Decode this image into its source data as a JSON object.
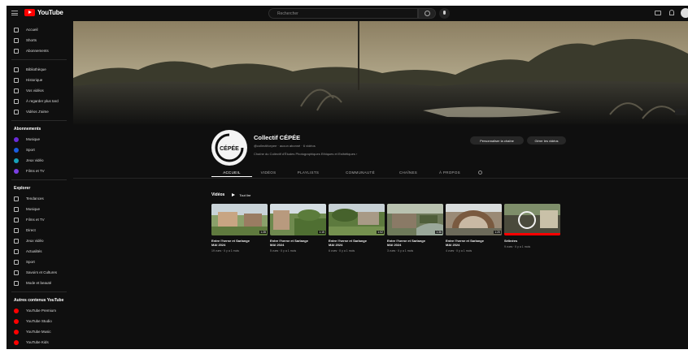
{
  "topbar": {
    "logo_text": "YouTube",
    "search_placeholder": "Rechercher"
  },
  "sidebar": {
    "main": [
      "Accueil",
      "Shorts",
      "Abonnements"
    ],
    "library": [
      "Bibliothèque",
      "Historique",
      "Vos vidéos",
      "À regarder plus tard",
      "Vidéos J'aime"
    ],
    "subs_title": "Abonnements",
    "subs": [
      {
        "label": "Musique",
        "color": "#6b2bd9"
      },
      {
        "label": "Sport",
        "color": "#1a5ce0"
      },
      {
        "label": "Jeux vidéo",
        "color": "#17a2b8"
      },
      {
        "label": "Films et TV",
        "color": "#7b3fe4"
      }
    ],
    "explore_title": "Explorer",
    "explore": [
      "Tendances",
      "Musique",
      "Films et TV",
      "Direct",
      "Jeux vidéo",
      "Actualités",
      "Sport",
      "Savoirs et Cultures",
      "Mode et beauté"
    ],
    "more_title": "Autres contenus YouTube",
    "more": [
      "YouTube Premium",
      "YouTube Studio",
      "YouTube Music",
      "YouTube Kids"
    ],
    "red": "#ff0000"
  },
  "channel": {
    "name": "Collectif CÉPÉE",
    "logo_text": "CÉPÉE",
    "handle": "@collectifcepee",
    "subscribers": "aucun abonné",
    "videos": "6 vidéos",
    "meta_sep": "·",
    "description": "Chaîne du Collectif d'Études Photographiques Ethiques et Esthétiques",
    "desc_chevron": "›",
    "customize_button": "Personnaliser la chaîne",
    "manage_button": "Gérer les vidéos"
  },
  "tabs": [
    "ACCUEIL",
    "VIDÉOS",
    "PLAYLISTS",
    "COMMUNAUTÉ",
    "CHAÎNES",
    "À PROPOS"
  ],
  "videos_section": {
    "title": "Vidéos",
    "play_all": "Tout lire"
  },
  "videos": [
    {
      "title": "Entre l'herne et Sarlange",
      "subtitle": "MAI 2024",
      "meta": "19 vues · Il y a 1 mois",
      "duration": "1:28"
    },
    {
      "title": "Entre l'herne et Sarlange",
      "subtitle": "MAI 2024",
      "meta": "5 vues · Il y a 1 mois",
      "duration": "1:15"
    },
    {
      "title": "Entre l'herne et Sarlange",
      "subtitle": "MAI 2024",
      "meta": "6 vues · Il y a 1 mois",
      "duration": "1:02"
    },
    {
      "title": "Entre l'herne et Sarlange",
      "subtitle": "MAI 2024",
      "meta": "3 vues · Il y a 1 mois",
      "duration": "1:36"
    },
    {
      "title": "Entre l'herne et Sarlange",
      "subtitle": "MAI 2024",
      "meta": "4 vues · Il y a 1 mois",
      "duration": "1:20"
    },
    {
      "title": "Sélinées",
      "subtitle": "",
      "meta": "9 vues · Il y a 1 mois",
      "duration": ""
    }
  ]
}
